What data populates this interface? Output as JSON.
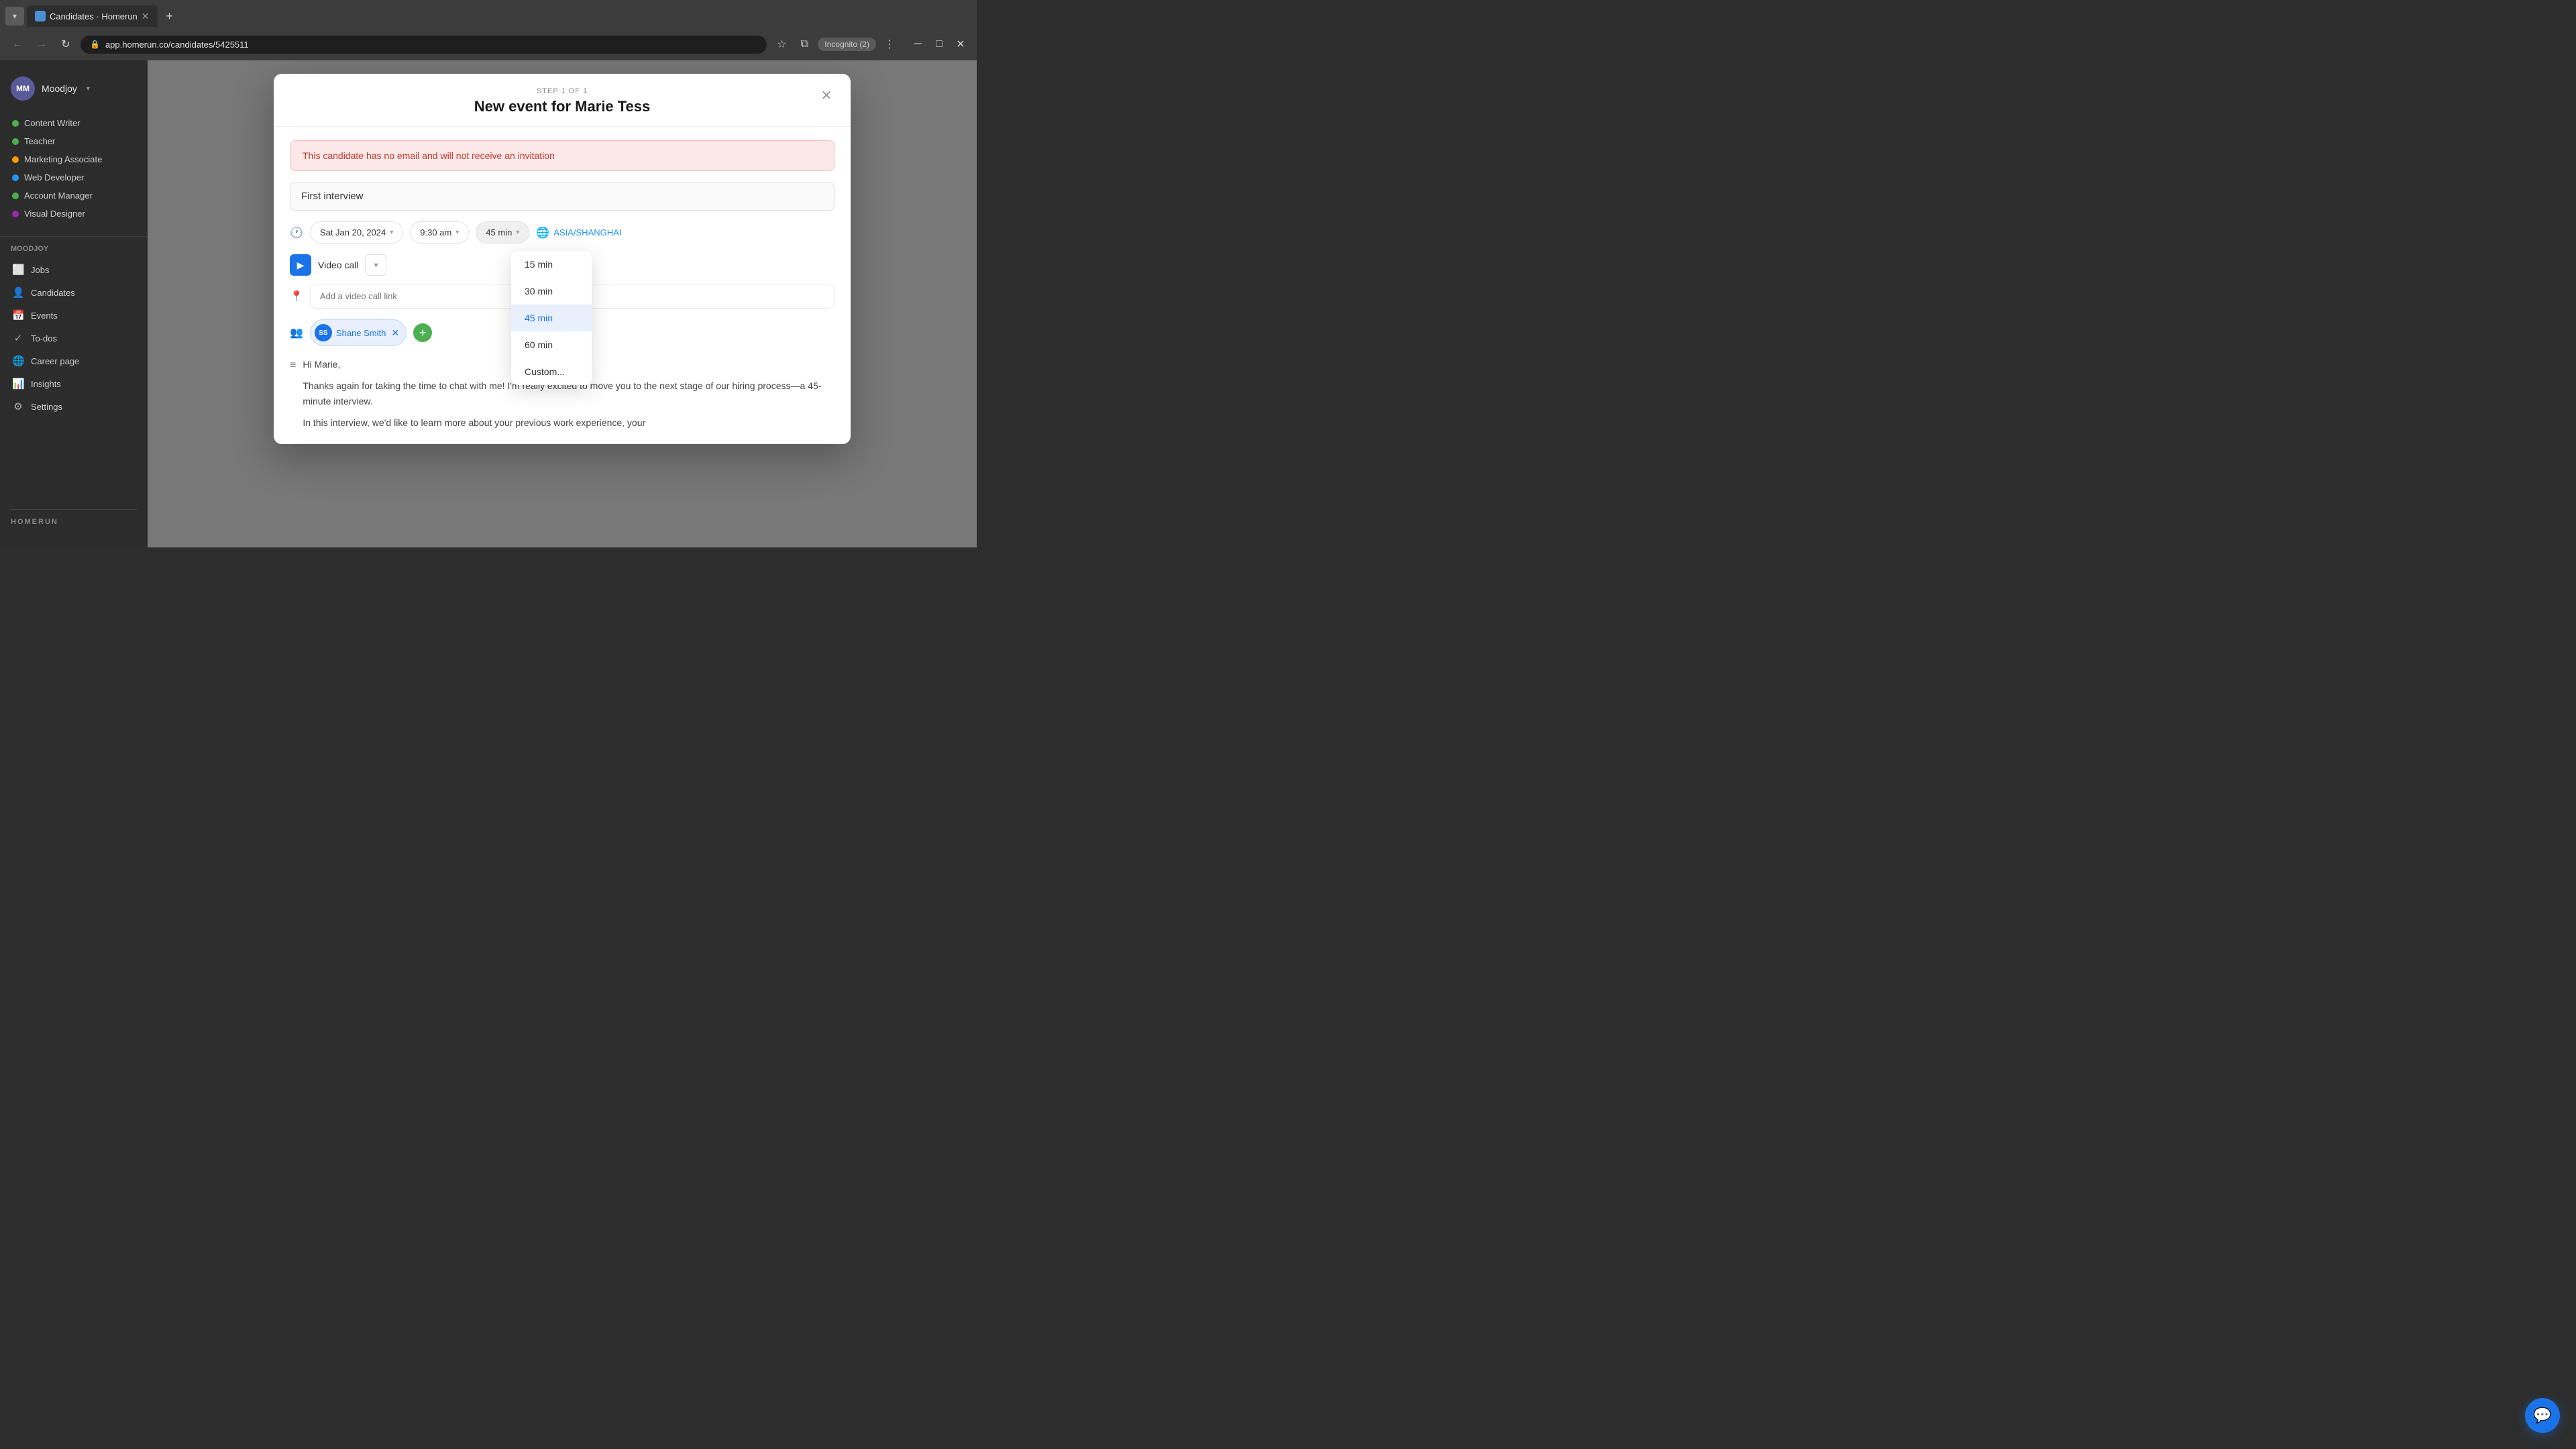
{
  "browser": {
    "tab_title": "Candidates · Homerun",
    "url": "app.homerun.co/candidates/5425511",
    "incognito_label": "Incognito (2)"
  },
  "sidebar": {
    "org_name": "Moodjoy",
    "avatar_initials": "MM",
    "jobs": [
      {
        "label": "Content Writer",
        "dot_color": "dot-green"
      },
      {
        "label": "Teacher",
        "dot_color": "dot-green"
      },
      {
        "label": "Marketing Associate",
        "dot_color": "dot-orange"
      },
      {
        "label": "Web Developer",
        "dot_color": "dot-blue"
      },
      {
        "label": "Account Manager",
        "dot_color": "dot-green"
      },
      {
        "label": "Visual Designer",
        "dot_color": "dot-purple"
      }
    ],
    "org_section_label": "Moodjoy",
    "nav_items": [
      {
        "label": "Jobs",
        "icon": "⬜"
      },
      {
        "label": "Candidates",
        "icon": "👤"
      },
      {
        "label": "Events",
        "icon": "📅"
      },
      {
        "label": "To-dos",
        "icon": "✓"
      },
      {
        "label": "Career page",
        "icon": "🌐"
      },
      {
        "label": "Insights",
        "icon": "📊"
      },
      {
        "label": "Settings",
        "icon": "⚙"
      }
    ],
    "logo": "HOMERUN"
  },
  "modal": {
    "step_label": "STEP 1 OF 1",
    "title": "New event for Marie Tess",
    "alert_text": "This candidate has no email and will not receive an invitation",
    "event_title_value": "First interview",
    "event_title_placeholder": "First interview",
    "date_value": "Sat Jan 20, 2024",
    "time_value": "9:30 am",
    "duration_value": "45 min",
    "timezone_label": "ASIA/SHANGHAI",
    "video_call_label": "Video call",
    "video_link_placeholder": "Add a video call link",
    "participant_name": "Shane Smith",
    "participant_initials": "SS",
    "message_greeting": "Hi Marie,",
    "message_body1": "Thanks again for taking the time to chat with me! I'm really excited to move you to the next stage of our hiring process—a 45-minute interview.",
    "message_body2": "In this interview, we'd like to learn more about your previous work experience, your",
    "duration_options": [
      {
        "label": "15 min",
        "selected": false
      },
      {
        "label": "30 min",
        "selected": false
      },
      {
        "label": "45 min",
        "selected": true
      },
      {
        "label": "60 min",
        "selected": false
      },
      {
        "label": "Custom...",
        "selected": false
      }
    ]
  }
}
